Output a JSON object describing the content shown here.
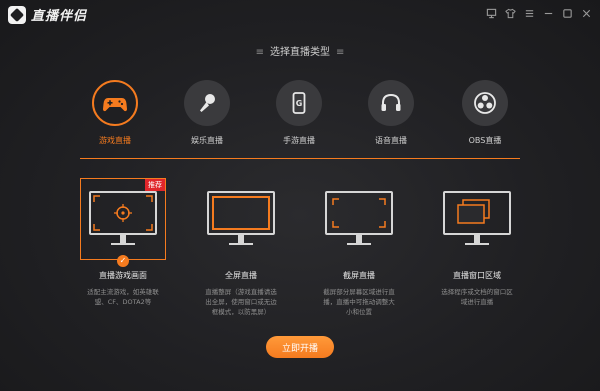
{
  "app": {
    "title": "直播伴侣"
  },
  "window_buttons": [
    "monitor-icon",
    "shirt-icon",
    "menu-icon",
    "minimize-icon",
    "maximize-icon",
    "close-icon"
  ],
  "heading": {
    "dots_left": "≡",
    "text": "选择直播类型",
    "dots_right": "≡"
  },
  "types": [
    {
      "label": "游戏直播",
      "icon": "gamepad-icon",
      "active": true
    },
    {
      "label": "娱乐直播",
      "icon": "microphone-icon",
      "active": false
    },
    {
      "label": "手游直播",
      "icon": "phone-icon",
      "active": false
    },
    {
      "label": "语音直播",
      "icon": "headphones-icon",
      "active": false
    },
    {
      "label": "OBS直播",
      "icon": "obs-icon",
      "active": false
    }
  ],
  "modes": [
    {
      "title": "直播游戏画面",
      "desc": "适配主流游戏，如英雄联盟、CF、DOTA2等",
      "badge": "推荐",
      "active": true
    },
    {
      "title": "全屏直播",
      "desc": "直播整屏（游戏直播请选出全屏，使用窗口或无边框模式，以防黑屏）",
      "active": false
    },
    {
      "title": "截屏直播",
      "desc": "截屏部分屏幕区域进行直播，直播中可拖动调整大小和位置",
      "active": false
    },
    {
      "title": "直播窗口区域",
      "desc": "选择程序或文档的窗口区域进行直播",
      "active": false
    }
  ],
  "start_button": "立即开播",
  "colors": {
    "accent": "#f57b1f",
    "badge": "#e0262b",
    "bg": "#202023"
  }
}
